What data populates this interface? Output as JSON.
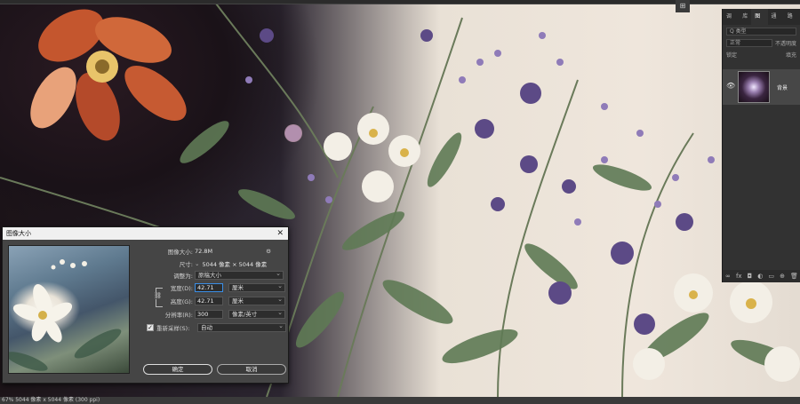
{
  "canvas": {
    "description_icon": "artwork-canvas"
  },
  "ruler": {
    "icon": "arrange-icon",
    "glyph": "⊞"
  },
  "status": {
    "text": "67%   5044 像素 x 5044 像素 (300 ppi)"
  },
  "layers_panel": {
    "tabs": [
      "调整",
      "库",
      "图层",
      "通道",
      "路径"
    ],
    "active_tab": "图层",
    "search_placeholder": "Q 类型",
    "blend_mode": "正常",
    "opacity_label": "不透明度",
    "lock_label": "锁定",
    "fill_label": "填充",
    "layer_name": "背景",
    "bottom_icons": [
      "∞",
      "fx",
      "◘",
      "◐",
      "▭",
      "⊕",
      "🗑"
    ]
  },
  "dialog": {
    "title": "图像大小",
    "close_glyph": "✕",
    "image_size_label": "图像大小:",
    "image_size_value": "72.8M",
    "dimensions_label": "尺寸:",
    "dimensions_value": "5044 像素 × 5044 像素",
    "fit_label": "调整为:",
    "fit_value": "原稿大小",
    "width_label": "宽度(D):",
    "width_value": "42.71",
    "width_unit": "厘米",
    "height_label": "高度(G):",
    "height_value": "42.71",
    "height_unit": "厘米",
    "resolution_label": "分辨率(R):",
    "resolution_value": "300",
    "resolution_unit": "像素/英寸",
    "resample_label": "重新采样(S):",
    "resample_value": "自动",
    "ok_label": "确定",
    "cancel_label": "取消"
  }
}
